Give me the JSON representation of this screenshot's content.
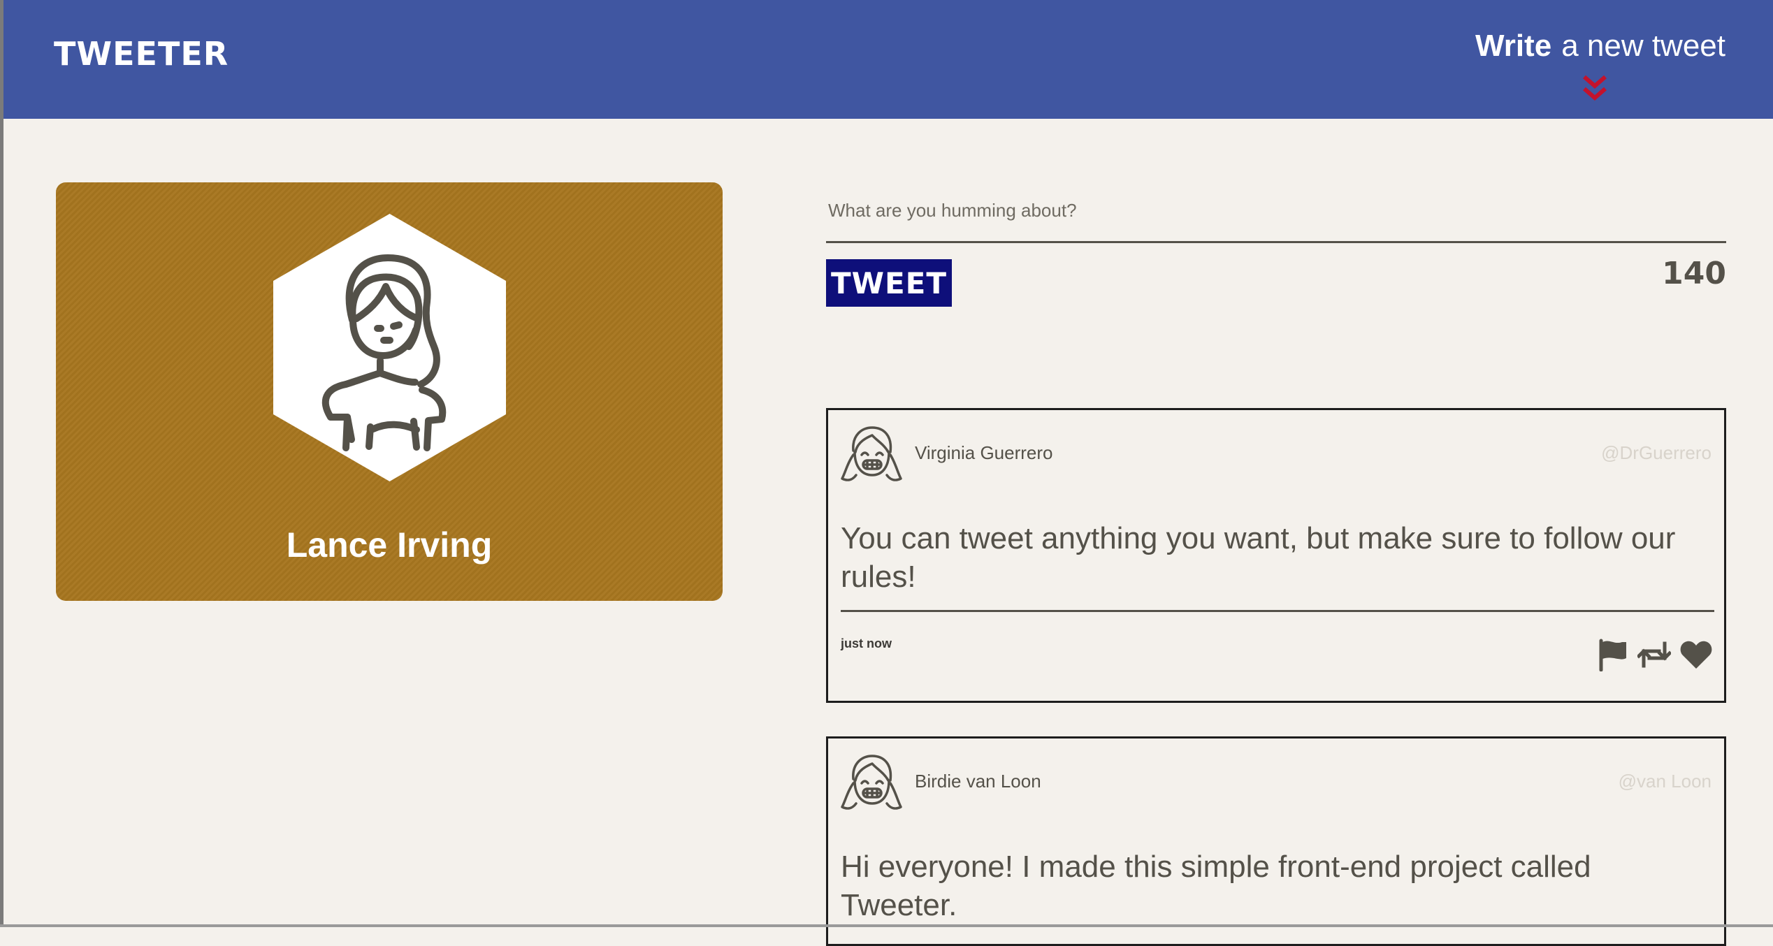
{
  "header": {
    "brand": "TWEETER",
    "compose_toggle": {
      "strong": "Write",
      "rest": "a new tweet"
    },
    "chevron_icon": "double-chevron-down-icon",
    "chevron_color": "#c3122c",
    "background": "#4056a1"
  },
  "profile": {
    "name": "Lance Irving",
    "avatar_icon": "woman-avatar-icon",
    "card_color": "#a7761f"
  },
  "composer": {
    "placeholder": "What are you humming about?",
    "value": "",
    "button_label": "TWEET",
    "counter": "140",
    "button_color": "#0e0f7a"
  },
  "tweets": [
    {
      "author": "Virginia Guerrero",
      "handle": "@DrGuerrero",
      "avatar_icon": "girl-avatar-icon",
      "body": "You can tweet anything you want, but make sure to follow our rules!",
      "time": "just now",
      "actions": [
        "flag-icon",
        "retweet-icon",
        "heart-icon"
      ]
    },
    {
      "author": "Birdie van Loon",
      "handle": "@van Loon",
      "avatar_icon": "girl-avatar-icon",
      "body": "Hi everyone! I made this simple front-end project called Tweeter."
    }
  ],
  "colors": {
    "page_background": "#f4f1ec",
    "text": "#545149",
    "handle": "#d8d3cb"
  }
}
